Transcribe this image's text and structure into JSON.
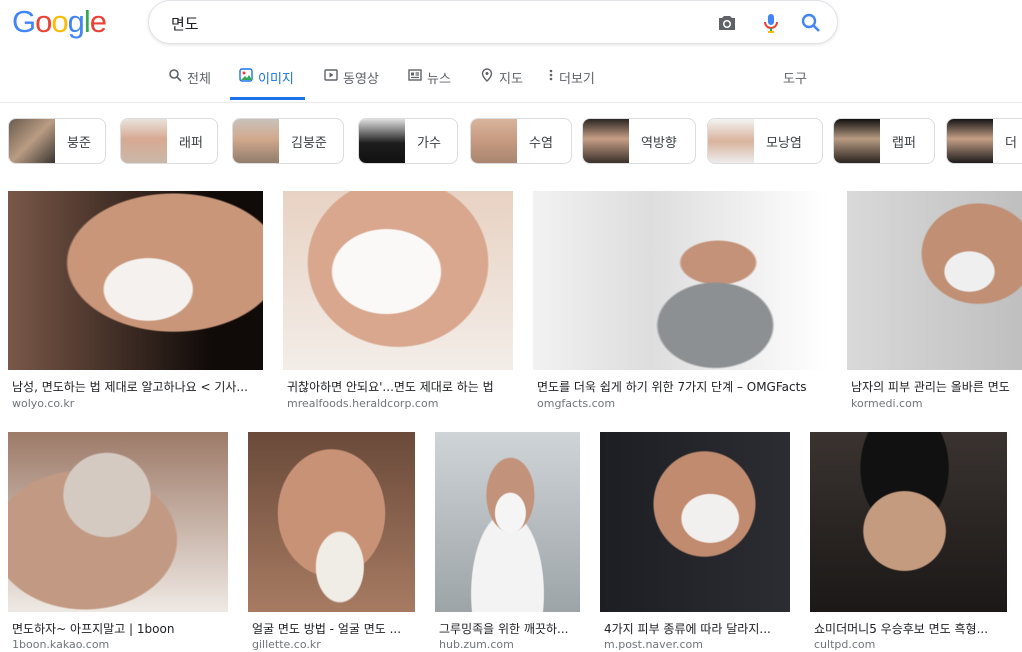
{
  "logo": {
    "letters": [
      "G",
      "o",
      "o",
      "g",
      "l",
      "e"
    ],
    "colors": [
      "#4285f4",
      "#ea4335",
      "#fbbc05",
      "#4285f4",
      "#34a853",
      "#ea4335"
    ]
  },
  "search": {
    "query": "면도"
  },
  "tabs": [
    {
      "label": "전체",
      "icon": "search-icon"
    },
    {
      "label": "이미지",
      "icon": "image-icon",
      "active": true
    },
    {
      "label": "동영상",
      "icon": "play-icon"
    },
    {
      "label": "뉴스",
      "icon": "news-icon"
    },
    {
      "label": "지도",
      "icon": "map-pin-icon"
    },
    {
      "label": "더보기",
      "icon": "more-vert-icon"
    }
  ],
  "tools_label": "도구",
  "chips": [
    "붕준",
    "래퍼",
    "김붕준",
    "가수",
    "수염",
    "역방향",
    "모낭염",
    "랩퍼",
    "더"
  ],
  "results": [
    {
      "caption": "남성, 면도하는 법 제대로 알고하나요 < 기사...",
      "source": "wolyo.co.kr"
    },
    {
      "caption": "귀찮아하면 안되요'...면도 제대로 하는 법",
      "source": "mrealfoods.heraldcorp.com"
    },
    {
      "caption": "면도를 더욱 쉽게 하기 위한 7가지 단계 – OMGFacts",
      "source": "omgfacts.com"
    },
    {
      "caption": "남자의 피부 관리는 올바른 면도",
      "source": "kormedi.com"
    },
    {
      "caption": "면도하자~ 아프지말고 | 1boon",
      "source": "1boon.kakao.com"
    },
    {
      "caption": "얼굴 면도 방법 - 얼굴 면도 ...",
      "source": "gillette.co.kr"
    },
    {
      "caption": "그루밍족을 위한 깨끗하...",
      "source": "hub.zum.com"
    },
    {
      "caption": "4가지 피부 종류에 따라 달라지...",
      "source": "m.post.naver.com"
    },
    {
      "caption": "쇼미더머니5 우승후보 면도 흑형...",
      "source": "cultpd.com"
    }
  ]
}
